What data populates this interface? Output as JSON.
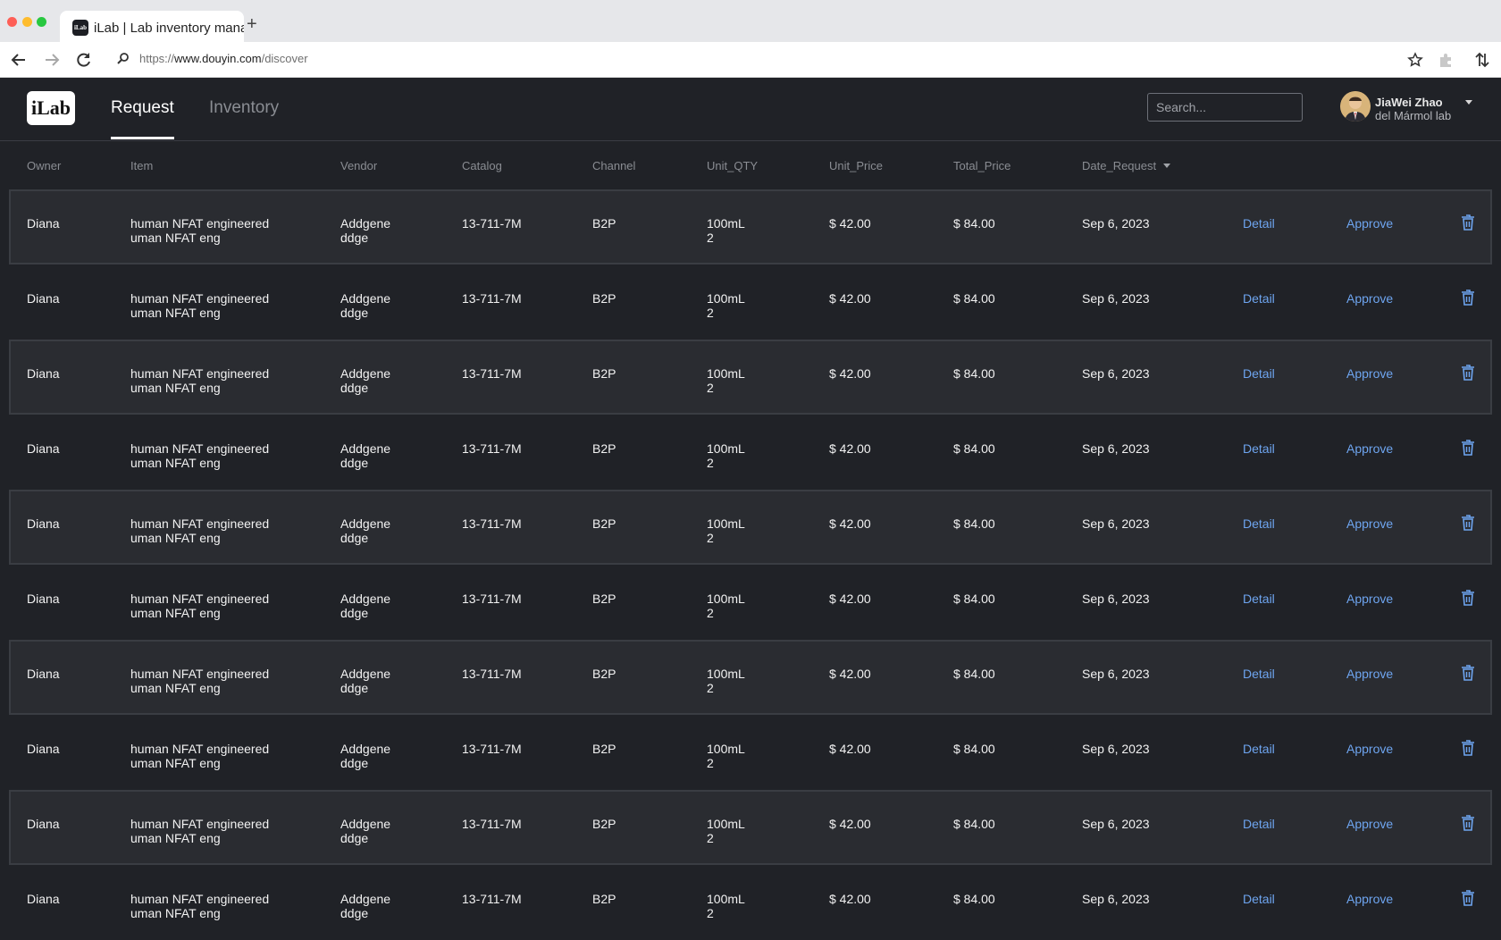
{
  "browser": {
    "tab_title": "iLab | Lab inventory management",
    "favicon_text": "iLab",
    "new_tab": "+",
    "url_scheme": "https://",
    "url_host": "www.douyin.com",
    "url_path": "/discover"
  },
  "header": {
    "logo": "iLab",
    "tabs": [
      {
        "label": "Request",
        "active": true
      },
      {
        "label": "Inventory",
        "active": false
      }
    ],
    "search_placeholder": "Search...",
    "user": {
      "name": "JiaWei Zhao",
      "lab": "del Mármol lab"
    }
  },
  "table": {
    "columns": [
      "Owner",
      "Item",
      "Vendor",
      "Catalog",
      "Channel",
      "Unit_QTY",
      "Unit_Price",
      "Total_Price",
      "Date_Request"
    ],
    "sorted_column": "Date_Request",
    "detail_label": "Detail",
    "approve_label": "Approve",
    "rows": [
      {
        "owner": "Diana",
        "item_line1": "human NFAT engineered",
        "item_line2": "uman NFAT eng",
        "vendor_line1": "Addgene",
        "vendor_line2": "ddge",
        "catalog": "13-711-7M",
        "channel": "B2P",
        "unit": "100mL",
        "qty": "2",
        "unit_price": "$ 42.00",
        "total_price": "$ 84.00",
        "date": "Sep 6, 2023"
      },
      {
        "owner": "Diana",
        "item_line1": "human NFAT engineered",
        "item_line2": "uman NFAT eng",
        "vendor_line1": "Addgene",
        "vendor_line2": "ddge",
        "catalog": "13-711-7M",
        "channel": "B2P",
        "unit": "100mL",
        "qty": "2",
        "unit_price": "$ 42.00",
        "total_price": "$ 84.00",
        "date": "Sep 6, 2023"
      },
      {
        "owner": "Diana",
        "item_line1": "human NFAT engineered",
        "item_line2": "uman NFAT eng",
        "vendor_line1": "Addgene",
        "vendor_line2": "ddge",
        "catalog": "13-711-7M",
        "channel": "B2P",
        "unit": "100mL",
        "qty": "2",
        "unit_price": "$ 42.00",
        "total_price": "$ 84.00",
        "date": "Sep 6, 2023"
      },
      {
        "owner": "Diana",
        "item_line1": "human NFAT engineered",
        "item_line2": "uman NFAT eng",
        "vendor_line1": "Addgene",
        "vendor_line2": "ddge",
        "catalog": "13-711-7M",
        "channel": "B2P",
        "unit": "100mL",
        "qty": "2",
        "unit_price": "$ 42.00",
        "total_price": "$ 84.00",
        "date": "Sep 6, 2023"
      },
      {
        "owner": "Diana",
        "item_line1": "human NFAT engineered",
        "item_line2": "uman NFAT eng",
        "vendor_line1": "Addgene",
        "vendor_line2": "ddge",
        "catalog": "13-711-7M",
        "channel": "B2P",
        "unit": "100mL",
        "qty": "2",
        "unit_price": "$ 42.00",
        "total_price": "$ 84.00",
        "date": "Sep 6, 2023"
      },
      {
        "owner": "Diana",
        "item_line1": "human NFAT engineered",
        "item_line2": "uman NFAT eng",
        "vendor_line1": "Addgene",
        "vendor_line2": "ddge",
        "catalog": "13-711-7M",
        "channel": "B2P",
        "unit": "100mL",
        "qty": "2",
        "unit_price": "$ 42.00",
        "total_price": "$ 84.00",
        "date": "Sep 6, 2023"
      },
      {
        "owner": "Diana",
        "item_line1": "human NFAT engineered",
        "item_line2": "uman NFAT eng",
        "vendor_line1": "Addgene",
        "vendor_line2": "ddge",
        "catalog": "13-711-7M",
        "channel": "B2P",
        "unit": "100mL",
        "qty": "2",
        "unit_price": "$ 42.00",
        "total_price": "$ 84.00",
        "date": "Sep 6, 2023"
      },
      {
        "owner": "Diana",
        "item_line1": "human NFAT engineered",
        "item_line2": "uman NFAT eng",
        "vendor_line1": "Addgene",
        "vendor_line2": "ddge",
        "catalog": "13-711-7M",
        "channel": "B2P",
        "unit": "100mL",
        "qty": "2",
        "unit_price": "$ 42.00",
        "total_price": "$ 84.00",
        "date": "Sep 6, 2023"
      },
      {
        "owner": "Diana",
        "item_line1": "human NFAT engineered",
        "item_line2": "uman NFAT eng",
        "vendor_line1": "Addgene",
        "vendor_line2": "ddge",
        "catalog": "13-711-7M",
        "channel": "B2P",
        "unit": "100mL",
        "qty": "2",
        "unit_price": "$ 42.00",
        "total_price": "$ 84.00",
        "date": "Sep 6, 2023"
      },
      {
        "owner": "Diana",
        "item_line1": "human NFAT engineered",
        "item_line2": "uman NFAT eng",
        "vendor_line1": "Addgene",
        "vendor_line2": "ddge",
        "catalog": "13-711-7M",
        "channel": "B2P",
        "unit": "100mL",
        "qty": "2",
        "unit_price": "$ 42.00",
        "total_price": "$ 84.00",
        "date": "Sep 6, 2023"
      }
    ]
  },
  "icons": {
    "back": "arrow-left-icon",
    "forward": "arrow-right-icon",
    "reload": "reload-icon",
    "url_search": "search-icon",
    "bookmark": "star-icon",
    "extension": "extension-icon",
    "sync": "sync-arrows-icon",
    "delete": "trash-icon",
    "user_menu": "caret-down-icon"
  },
  "colors": {
    "background": "#202227",
    "row_striped": "#2a2c31",
    "link": "#6ea5f0",
    "header_muted": "#8a8d93"
  }
}
